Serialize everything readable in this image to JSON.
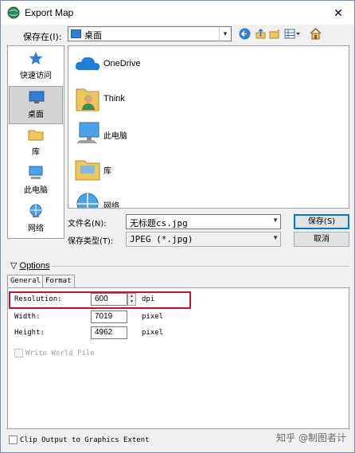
{
  "window": {
    "title": "Export Map",
    "close_glyph": "✕"
  },
  "lookin": {
    "label": "保存在(I):",
    "value": "桌面"
  },
  "places": [
    {
      "label": "快速访问",
      "icon": "star-icon"
    },
    {
      "label": "桌面",
      "icon": "desktop-icon",
      "selected": true
    },
    {
      "label": "库",
      "icon": "folder-icon"
    },
    {
      "label": "此电脑",
      "icon": "computer-icon"
    },
    {
      "label": "网络",
      "icon": "network-icon"
    }
  ],
  "files": [
    {
      "label": "OneDrive",
      "icon": "cloud-icon"
    },
    {
      "label": "Think",
      "icon": "user-folder-icon"
    },
    {
      "label": "此电脑",
      "icon": "computer-icon"
    },
    {
      "label": "库",
      "icon": "folder-icon"
    },
    {
      "label": "网络",
      "icon": "network-icon"
    }
  ],
  "filename": {
    "label": "文件名(N):",
    "value": "无标题cs.jpg"
  },
  "filetype": {
    "label": "保存类型(T):",
    "value": "JPEG (*.jpg)"
  },
  "buttons": {
    "save": "保存(S)",
    "cancel": "取消"
  },
  "options": {
    "header": "Options",
    "toggle_glyph": "▽"
  },
  "tabs": [
    {
      "label": "General",
      "active": true
    },
    {
      "label": "Format",
      "active": false
    }
  ],
  "general": {
    "resolution": {
      "label": "Resolution:",
      "value": "600",
      "unit": "dpi"
    },
    "width": {
      "label": "Width:",
      "value": "7019",
      "unit": "pixel"
    },
    "height": {
      "label": "Height:",
      "value": "4962",
      "unit": "pixel"
    },
    "world_file": {
      "label": "Write World File",
      "checked": false,
      "enabled": false
    }
  },
  "clip_output": {
    "label": "Clip Output to Graphics Extent",
    "checked": false
  },
  "watermark": "知乎 @制图者计",
  "colors": {
    "highlight": "#c8102e",
    "accent": "#0078d7",
    "folder": "#f2c55c"
  }
}
